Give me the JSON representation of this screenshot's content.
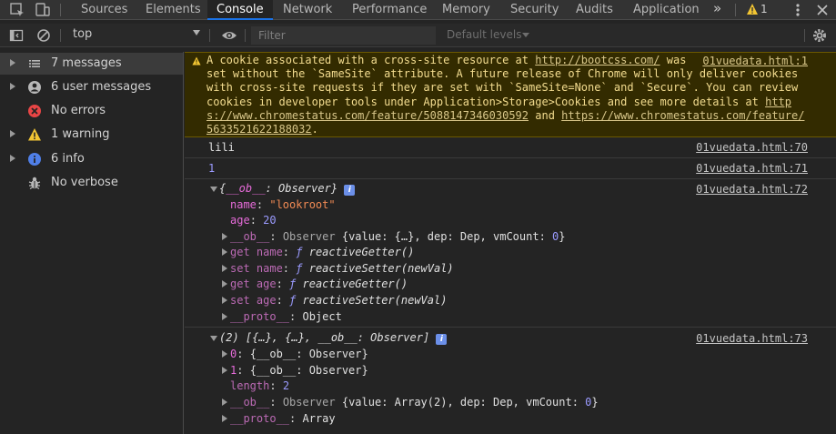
{
  "tabs": {
    "sources": "Sources",
    "elements": "Elements",
    "console": "Console",
    "network": "Network",
    "performance": "Performance",
    "memory": "Memory",
    "security": "Security",
    "audits": "Audits",
    "application": "Application",
    "more": "»",
    "warning_count": "1"
  },
  "toolbar": {
    "context": "top",
    "filter_placeholder": "Filter",
    "levels": "Default levels"
  },
  "sidebar": {
    "items": [
      {
        "label": "7 messages",
        "icon": "list-icon"
      },
      {
        "label": "6 user messages",
        "icon": "user-icon"
      },
      {
        "label": "No errors",
        "icon": "error-icon"
      },
      {
        "label": "1 warning",
        "icon": "warning-icon"
      },
      {
        "label": "6 info",
        "icon": "info-icon"
      },
      {
        "label": "No verbose",
        "icon": "bug-icon"
      }
    ]
  },
  "console": {
    "warning": {
      "line1_a": "A cookie associated with a cross-site resource at ",
      "link1": "http://bootcss.com/",
      "line1_b": " was ",
      "source": "01vuedata.html:1",
      "line2": "set without the `SameSite` attribute. A future release of Chrome will only deliver cookies",
      "line3": "with cross-site requests if they are set with `SameSite=None` and `Secure`. You can review",
      "line4_a": "cookies in developer tools under Application>Storage>Cookies and see more details at ",
      "link2a": "http",
      "link2b": "s://www.chromestatus.com/feature/5088147346030592",
      "line5_mid": " and ",
      "link3a": "https://www.chromestatus.com/feature/",
      "link3b": "5633521622188032",
      "line6_end": "."
    },
    "log1": {
      "text": "lili",
      "source": "01vuedata.html:70"
    },
    "log2": {
      "text": "1",
      "source": "01vuedata.html:71"
    },
    "log3": {
      "source": "01vuedata.html:72",
      "header_a": "{",
      "header_key": "__ob__",
      "header_b": ": Observer}",
      "name_key": "name",
      "name_val": "\"lookroot\"",
      "age_key": "age",
      "age_val": "20",
      "ob_key": "__ob__",
      "ob_val_a": "Observer ",
      "ob_val_b": "{value: {…}, dep: Dep, vmCount: ",
      "ob_val_num": "0",
      "ob_val_c": "}",
      "get_name": "get name",
      "set_name": "set name",
      "get_age": "get age",
      "set_age": "set age",
      "f": "ƒ",
      "reactive_getter": "reactiveGetter()",
      "reactive_setter": "reactiveSetter(newVal)",
      "proto_key": "__proto__",
      "proto_val": "Object"
    },
    "log4": {
      "source": "01vuedata.html:73",
      "header": "(2) [{…}, {…}, __ob__: Observer]",
      "item0_key": "0",
      "item0_val": "{__ob__: Observer}",
      "item1_key": "1",
      "item1_val": "{__ob__: Observer}",
      "length_key": "length",
      "length_val": "2",
      "ob_key": "__ob__",
      "ob_val_a": "Observer ",
      "ob_val_b": "{value: Array(2), dep: Dep, vmCount: ",
      "ob_val_num": "0",
      "ob_val_c": "}",
      "proto_key": "__proto__",
      "proto_val": "Array"
    }
  },
  "colors": {
    "accent": "#1a73e8",
    "warning_bg": "#332b00",
    "warning_text": "#f3dc8f",
    "key": "#e56bd8",
    "string": "#f28b54",
    "number": "#9b9bff"
  }
}
